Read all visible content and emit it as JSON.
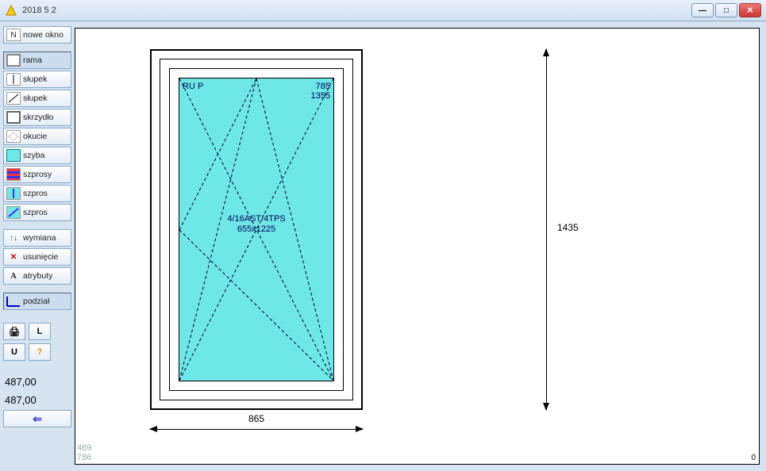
{
  "titlebar": {
    "title": "2018    5   2"
  },
  "sidebar": {
    "nowe_okno": "nowe okno",
    "rama": "rama",
    "slupek1": "słupek",
    "slupek2": "słupek",
    "skrzydlo": "skrzydło",
    "okucie": "okucie",
    "szyba": "szyba",
    "szprosy": "szprosy",
    "szpros1": "szpros",
    "szpros2": "szpros",
    "wymiana": "wymiana",
    "usuniecie": "usunięcie",
    "atrybuty": "atrybuty",
    "podzial": "podział",
    "print": "⎙",
    "L": "L",
    "U": "U",
    "help": "?"
  },
  "prices": {
    "p1": "487,00",
    "p2": "487,00"
  },
  "back": "⇐",
  "canvas": {
    "coord_x": "469",
    "coord_y": "786",
    "zero": "0"
  },
  "drawing": {
    "hardware": "RU P",
    "w_small": "785",
    "h_small": "1355",
    "glass_spec": "4/16AST/4TPS",
    "glass_dim": "655x1225",
    "dim_h": "865",
    "dim_v": "1435"
  }
}
